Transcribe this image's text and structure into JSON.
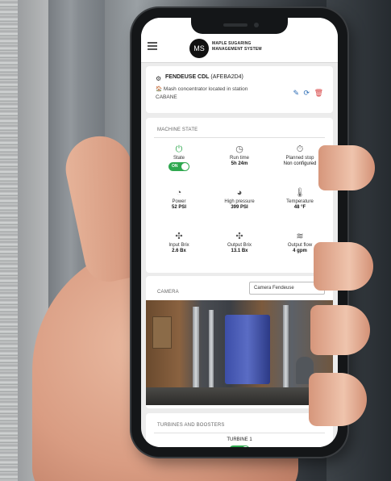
{
  "app": {
    "logo_text": "MS",
    "brand_line1": "MAPLE SUGARING",
    "brand_line2": "MANAGEMENT SYSTEM"
  },
  "device": {
    "name": "FENDEUSE CDL",
    "code": "(AFEBA2D4)",
    "description": "Mash concentrator located in station CABANE"
  },
  "machine_state": {
    "title": "MACHINE STATE",
    "metrics": [
      {
        "label": "State",
        "value": "ON",
        "icon": "power-icon",
        "kind": "toggle"
      },
      {
        "label": "Run time",
        "value": "5h 24m",
        "icon": "clock-icon"
      },
      {
        "label": "Planned stop",
        "value": "Non configured",
        "icon": "timer-icon"
      },
      {
        "label": "Power",
        "value": "52 PSI",
        "icon": "gauge-icon"
      },
      {
        "label": "High pressure",
        "value": "399 PSI",
        "icon": "gauge-icon"
      },
      {
        "label": "Temperature",
        "value": "48 °F",
        "icon": "thermometer-icon"
      },
      {
        "label": "Input Brix",
        "value": "2.6 Bx",
        "icon": "molecule-icon"
      },
      {
        "label": "Output Brix",
        "value": "13.1 Bx",
        "icon": "molecule-icon"
      },
      {
        "label": "Output flow",
        "value": "4 gpm",
        "icon": "flow-icon"
      }
    ]
  },
  "camera": {
    "title": "CAMERA",
    "selected": "Camera Fendeuse"
  },
  "turbines": {
    "title": "TURBINES AND BOOSTERS",
    "item_label": "TURBINE 1",
    "item_state": "ON"
  }
}
